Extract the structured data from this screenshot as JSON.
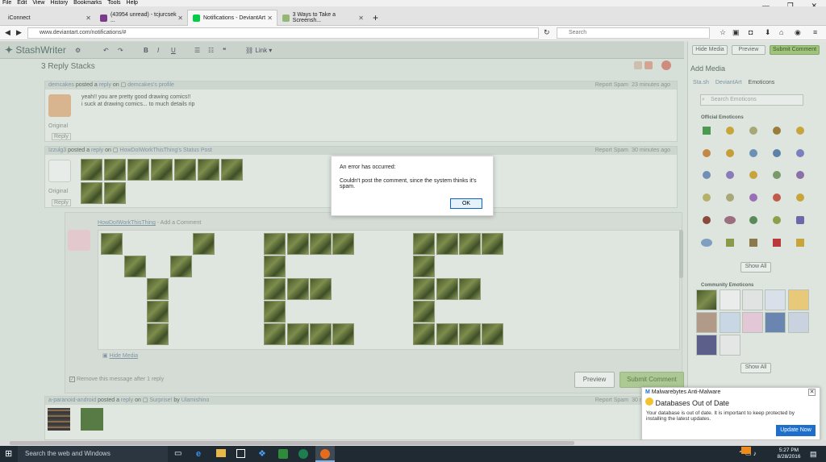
{
  "menu": [
    "File",
    "Edit",
    "View",
    "History",
    "Bookmarks",
    "Tools",
    "Help"
  ],
  "tabs": [
    {
      "label": "iConnect",
      "icon": "iconnect-icon"
    },
    {
      "label": "(43954 unread) - tcjurcsek ...",
      "icon": "mail-icon"
    },
    {
      "label": "Notifications - DeviantArt",
      "icon": "deviantart-icon"
    },
    {
      "label": "3 Ways to Take a Screensh...",
      "icon": "wikihow-icon"
    }
  ],
  "nav": {
    "url": "www.deviantart.com/notifications/#",
    "search_placeholder": "Search"
  },
  "writer": {
    "logo": "StashWriter",
    "link_label": "Link",
    "hide_media": "Hide Media",
    "preview": "Preview",
    "submit": "Submit Comment"
  },
  "section_title": "3 Reply Stacks",
  "comments": [
    {
      "user": "demcakes",
      "action": "posted a",
      "reply": "reply",
      "on": "on",
      "target": "demcakes's profile",
      "time": "23 minutes ago",
      "report": "Report Spam",
      "text1": "yeah!! you are pretty good drawing comics!!",
      "text2": "i suck at drawing comics... to much details rip",
      "original": "Original",
      "replylink": "Reply"
    },
    {
      "user": "Izzulg3",
      "action": "posted a",
      "reply": "reply",
      "on": "on",
      "target": "HowDoIWorkThisThing's Status Post",
      "time": "30 minutes ago",
      "report": "Report Spam",
      "original": "Original",
      "replylink": "Reply"
    },
    {
      "user": "a-paranoid-android",
      "action": "posted a",
      "reply": "reply",
      "on": "on",
      "target": "Surprise!",
      "by": "by",
      "author": "Ulamishino",
      "time": "30 minutes ago",
      "report": "Report Spam"
    }
  ],
  "reply_box": {
    "user": "HowDoIWorkThisThing",
    "add": "- Add a Comment",
    "hide_media": "Hide Media",
    "remove_msg": "Remove this message after 1 reply",
    "preview": "Preview",
    "submit": "Submit Comment"
  },
  "media": {
    "title": "Add Media",
    "tabs": [
      "Sta.sh",
      "DeviantArt",
      "Emoticons"
    ],
    "search_placeholder": "Search Emoticons",
    "official": "Official Emoticons",
    "community": "Community Emoticons",
    "show_all": "Show All"
  },
  "modal": {
    "title": "An error has occurred:",
    "message": "Couldn't post the comment, since the system thinks it's spam.",
    "ok": "OK"
  },
  "malwarebytes": {
    "app": "Malwarebytes Anti-Malware",
    "heading": "Databases Out of Date",
    "body": "Your database is out of date. It is important to keep protected by installing the latest updates.",
    "button": "Update Now"
  },
  "taskbar": {
    "search": "Search the web and Windows",
    "time": "5:27 PM",
    "date": "8/28/2016"
  },
  "colors": {
    "accent": "#9fc27d",
    "modal_ok": "#0a64c8",
    "mb_button": "#1d6fcb",
    "taskbar": "#1f2a33"
  }
}
